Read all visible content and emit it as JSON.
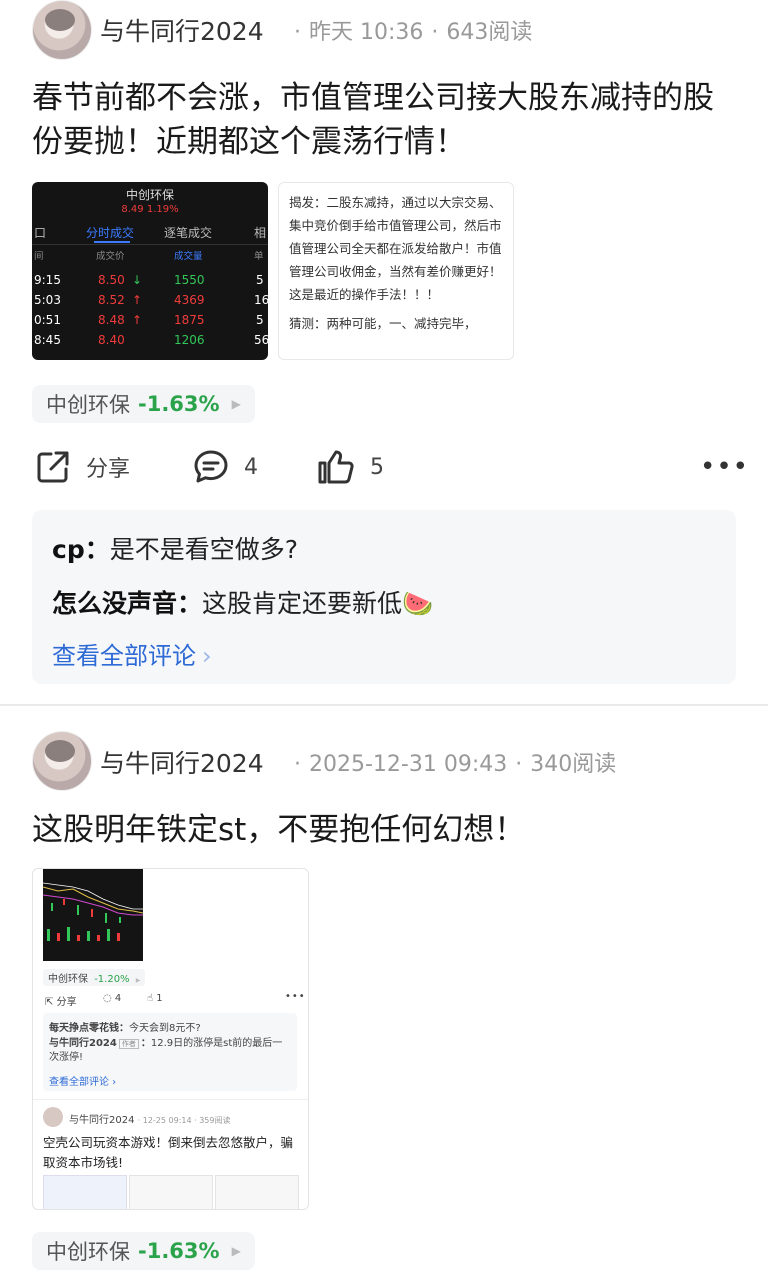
{
  "post1": {
    "author": "与牛同行2024",
    "time": "昨天 10:36",
    "reads": "643阅读",
    "content": "春节前都不会涨，市值管理公司接大股东减持的股份要抛！近期都这个震荡行情！",
    "image1": {
      "stock_name": "中创环保",
      "price_line": "8.49  1.19%",
      "tab_left": "口",
      "tab1": "分时成交",
      "tab2": "逐笔成交",
      "tab3": "相",
      "col_time": "间",
      "col_price": "成交价",
      "col_vol": "成交量",
      "col_unit": "单",
      "rows": [
        {
          "time": "9:15",
          "price": "8.50",
          "dir": "↓",
          "vol": "1550",
          "tail": "5"
        },
        {
          "time": "5:03",
          "price": "8.52",
          "dir": "↑",
          "vol": "4369",
          "tail": "16"
        },
        {
          "time": "0:51",
          "price": "8.48",
          "dir": "↑",
          "vol": "1875",
          "tail": "5"
        },
        {
          "time": "8:45",
          "price": "8.40",
          "dir": "",
          "vol": "1206",
          "tail": "56"
        }
      ]
    },
    "image2": {
      "text1": "揭发：二股东减持，通过以大宗交易、集中竞价倒手给市值管理公司，然后市值管理公司全天都在派发给散户！市值管理公司收佣金，当然有差价赚更好！这是最近的操作手法！！！",
      "text2": "猜测：两种可能，一、减持完毕，"
    },
    "stock_tag": {
      "name": "中创环保",
      "pct": "-1.63%"
    },
    "actions": {
      "share": "分享",
      "comments": "4",
      "likes": "5"
    },
    "comments": [
      {
        "user": "cp",
        "text": "是不是看空做多?"
      },
      {
        "user": "怎么没声音",
        "text": "这股肯定还要新低🍉"
      }
    ],
    "view_all": "查看全部评论"
  },
  "post2": {
    "author": "与牛同行2024",
    "time": "2025-12-31 09:43",
    "reads": "340阅读",
    "content": "这股明年铁定st，不要抱任何幻想！",
    "shot": {
      "stock_tag": "中创环保",
      "stock_pct": "-1.20%",
      "share": "分享",
      "comments": "4",
      "likes": "1",
      "c1_user": "每天挣点零花钱",
      "c1_text": "今天会到8元不?",
      "c2_user": "与牛同行2024",
      "c2_badge": "作者",
      "c2_text": "12.9日的涨停是st前的最后一次涨停!",
      "view_all": "查看全部评论",
      "inner_author": "与牛同行2024",
      "inner_time": "12-25 09:14",
      "inner_reads": "359阅读",
      "inner_content": "空壳公司玩资本游戏！倒来倒去忽悠散户，骗取资本市场钱!"
    },
    "stock_tag": {
      "name": "中创环保",
      "pct": "-1.63%"
    }
  },
  "colors": {
    "down_green": "#2aa34a",
    "link_blue": "#2d6ad6",
    "up_red": "#f03b3b"
  }
}
